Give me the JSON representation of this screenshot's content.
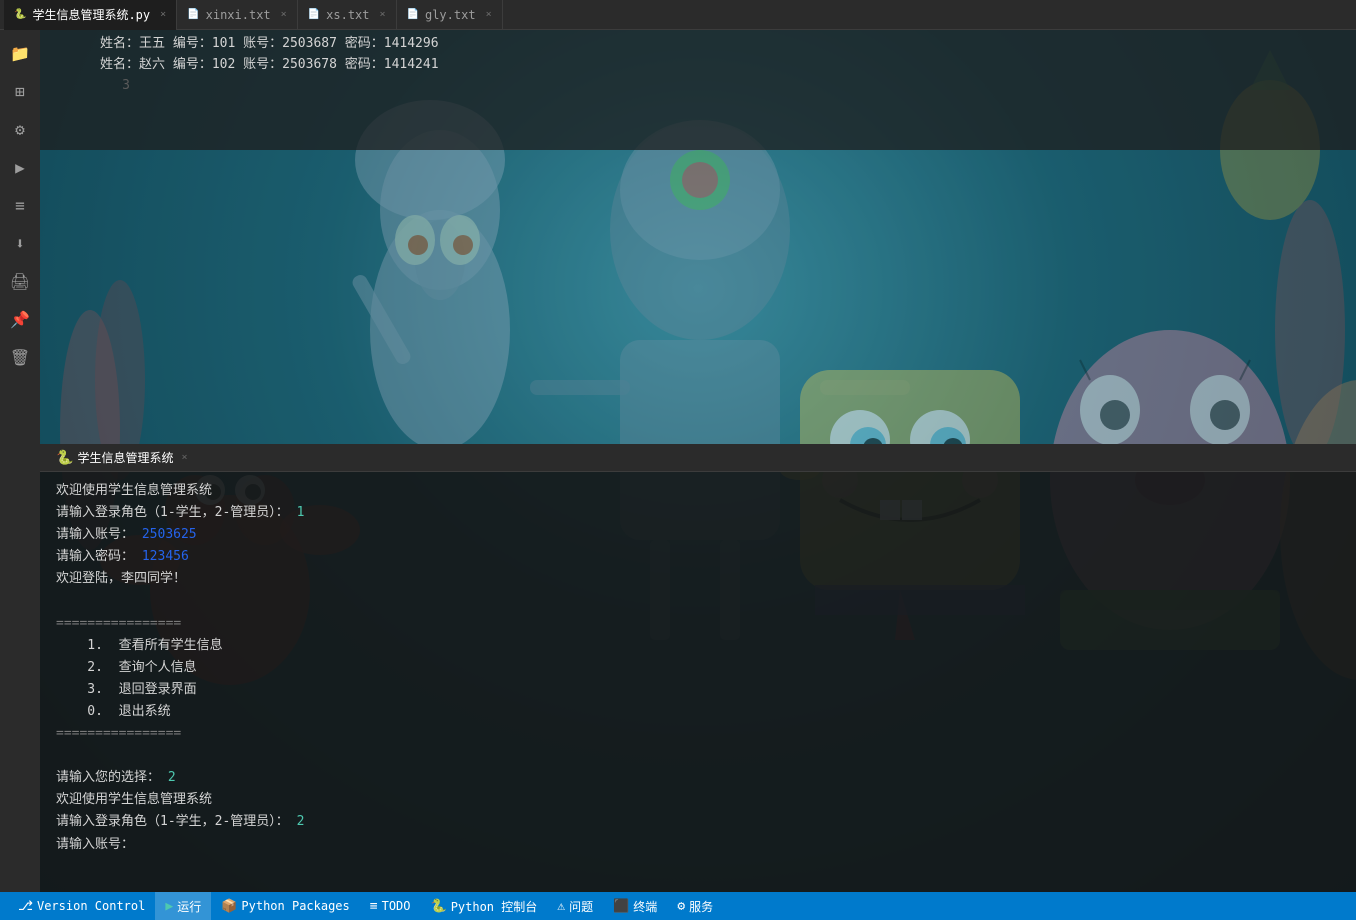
{
  "tabs": [
    {
      "id": "tab-py",
      "label": "学生信息管理系统.py",
      "type": "py",
      "active": false
    },
    {
      "id": "tab-xinxi",
      "label": "xinxi.txt",
      "type": "txt",
      "active": false
    },
    {
      "id": "tab-xs",
      "label": "xs.txt",
      "type": "txt",
      "active": false
    },
    {
      "id": "tab-gly",
      "label": "gly.txt",
      "type": "txt",
      "active": true
    }
  ],
  "file_content": {
    "lines": [
      {
        "num": "",
        "text": "姓名：王五  编号：101  账号：2503687  密码：1414296"
      },
      {
        "num": "",
        "text": "姓名：赵六  编号：102  账号：2503678  密码：1414241"
      },
      {
        "num": "3",
        "text": ""
      }
    ]
  },
  "terminal": {
    "run_tab": {
      "emoji": "🐍",
      "label": "学生信息管理系统",
      "close": "×"
    },
    "lines": [
      {
        "text": "欢迎使用学生信息管理系统",
        "style": "white"
      },
      {
        "text": "请输入登录角色（1-学生，2-管理员）：",
        "style": "white",
        "input": "1"
      },
      {
        "text": "请输入账号：",
        "style": "white",
        "input": "2503625"
      },
      {
        "text": "请输入密码：",
        "style": "white",
        "input": "123456"
      },
      {
        "text": "欢迎登陆，李四同学！",
        "style": "white"
      },
      {
        "text": "",
        "style": ""
      },
      {
        "text": "================",
        "style": "dim"
      },
      {
        "text": "    1.  查看所有学生信息",
        "style": "white"
      },
      {
        "text": "    2.  查询个人信息",
        "style": "white"
      },
      {
        "text": "    3.  退回登录界面",
        "style": "white"
      },
      {
        "text": "    0.  退出系统",
        "style": "white"
      },
      {
        "text": "================",
        "style": "dim"
      },
      {
        "text": "",
        "style": ""
      },
      {
        "text": "请输入您的选择：",
        "style": "white",
        "input": "2"
      },
      {
        "text": "欢迎使用学生信息管理系统",
        "style": "white"
      },
      {
        "text": "请输入登录角色（1-学生，2-管理员）：",
        "style": "white",
        "input": "2"
      },
      {
        "text": "请输入账号：",
        "style": "white"
      }
    ]
  },
  "statusbar": {
    "items": [
      {
        "icon": "⎇",
        "label": "Version Control",
        "active": false
      },
      {
        "icon": "▶",
        "label": "运行",
        "active": true
      },
      {
        "icon": "📦",
        "label": "Python Packages",
        "active": false
      },
      {
        "icon": "≡",
        "label": "TODO",
        "active": false
      },
      {
        "icon": "🐍",
        "label": "Python 控制台",
        "active": false
      },
      {
        "icon": "⚠",
        "label": "问题",
        "active": false
      },
      {
        "icon": "⬛",
        "label": "终端",
        "active": false
      },
      {
        "icon": "⚙",
        "label": "服务",
        "active": false
      }
    ]
  },
  "sidebar": {
    "icons": [
      {
        "name": "folder-icon",
        "symbol": "📁"
      },
      {
        "name": "structure-icon",
        "symbol": "⊞"
      },
      {
        "name": "settings-icon",
        "symbol": "⚙"
      },
      {
        "name": "run-config-icon",
        "symbol": "▶"
      },
      {
        "name": "bookmarks-icon",
        "symbol": "≡"
      },
      {
        "name": "arrow-down-icon",
        "symbol": "⬇"
      },
      {
        "name": "print-icon",
        "symbol": "🖨"
      },
      {
        "name": "pin-icon",
        "symbol": "📌"
      },
      {
        "name": "delete-icon",
        "symbol": "🗑"
      }
    ]
  }
}
